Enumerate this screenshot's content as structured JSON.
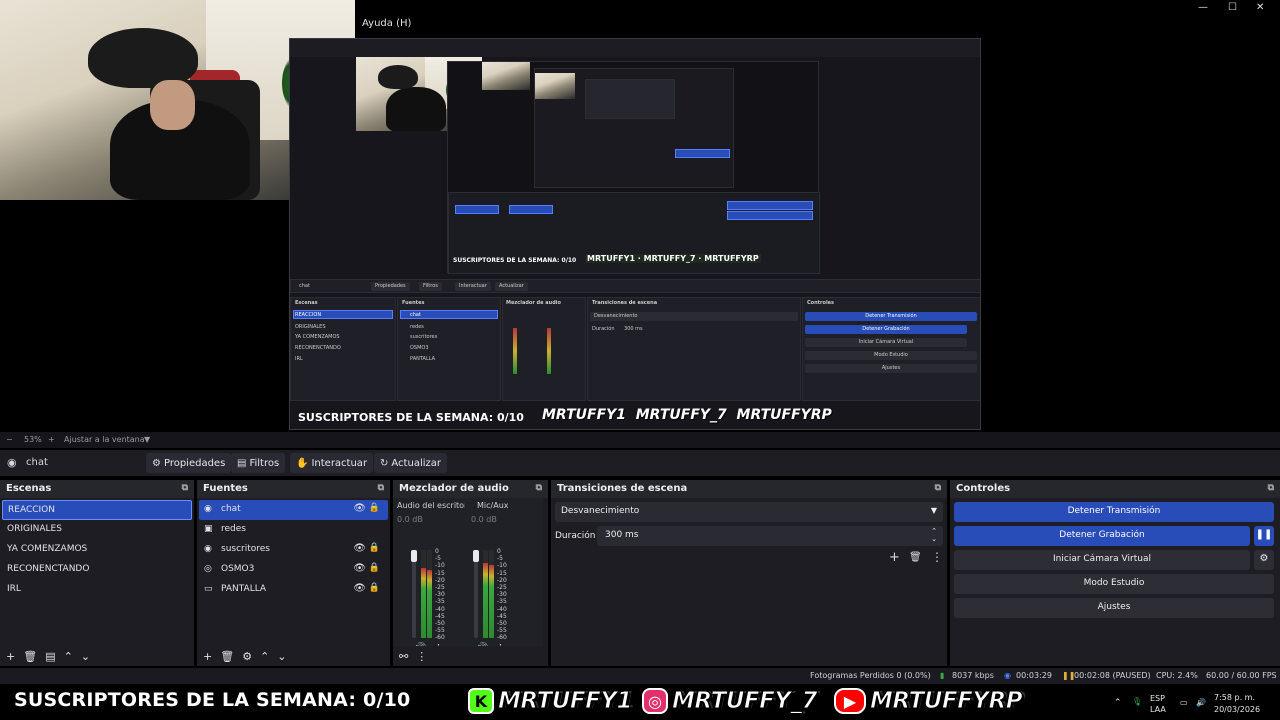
{
  "window": {
    "menu_help": "Ayuda (H)",
    "minimize": "—",
    "maximize": "☐",
    "close": "✕"
  },
  "zoom": {
    "minus": "−",
    "value": "53%",
    "plus": "+",
    "fit": "Ajustar a la ventana"
  },
  "toolbar": {
    "source_name": "chat",
    "properties": "Propiedades",
    "filters": "Filtros",
    "interact": "Interactuar",
    "refresh": "Actualizar"
  },
  "scenes": {
    "title": "Escenas",
    "items": [
      "REACCION",
      "ORIGINALES",
      "YA COMENZAMOS",
      "RECONENCTANDO",
      "IRL"
    ],
    "selected": "REACCION"
  },
  "sources": {
    "title": "Fuentes",
    "items": [
      {
        "name": "chat",
        "icon": "globe-icon",
        "visible": true,
        "locked": true
      },
      {
        "name": "redes",
        "icon": "image-icon",
        "visible": false,
        "locked": false
      },
      {
        "name": "suscritores",
        "icon": "globe-icon",
        "visible": true,
        "locked": true
      },
      {
        "name": "OSMO3",
        "icon": "camera-icon",
        "visible": true,
        "locked": true
      },
      {
        "name": "PANTALLA",
        "icon": "monitor-icon",
        "visible": true,
        "locked": true
      }
    ]
  },
  "mixer": {
    "title": "Mezclador de audio",
    "channels": [
      {
        "name": "Audio del escritorio",
        "db": "0.0 dB",
        "level": 0.8
      },
      {
        "name": "Mic/Aux",
        "db": "0.0 dB",
        "level": 0.85
      }
    ],
    "scale": [
      "0",
      "-5",
      "-10",
      "-15",
      "-20",
      "-25",
      "-30",
      "-35",
      "-40",
      "-45",
      "-50",
      "-55",
      "-60"
    ]
  },
  "transitions": {
    "title": "Transiciones de escena",
    "selected": "Desvanecimiento",
    "duration_label": "Duración",
    "duration_value": "300 ms"
  },
  "controls": {
    "title": "Controles",
    "stop_stream": "Detener Transmisión",
    "stop_record": "Detener Grabación",
    "virtual_cam": "Iniciar Cámara Virtual",
    "studio_mode": "Modo Estudio",
    "settings": "Ajustes"
  },
  "status": {
    "dropped": "Fotogramas Perdidos 0 (0.0%)",
    "kbps": "8037 kbps",
    "stream_time": "00:03:29",
    "record_time": "00:02:08 (PAUSED)",
    "cpu": "CPU: 2.4%",
    "fps": "60.00 / 60.00 FPS"
  },
  "overlay": {
    "subs": "SUSCRIPTORES DE LA SEMANA: 0/10",
    "kick": "MRTUFFY1",
    "instagram": "MRTUFFY_7",
    "youtube": "MRTUFFYRP"
  },
  "tray": {
    "lang": "ESP",
    "layout": "LAA",
    "time": "7:58 p. m.",
    "date": "20/03/2026"
  },
  "colors": {
    "accent": "#284cb8",
    "kick": "#53fc18",
    "instagram": "#e1306c",
    "youtube": "#ff0000"
  }
}
